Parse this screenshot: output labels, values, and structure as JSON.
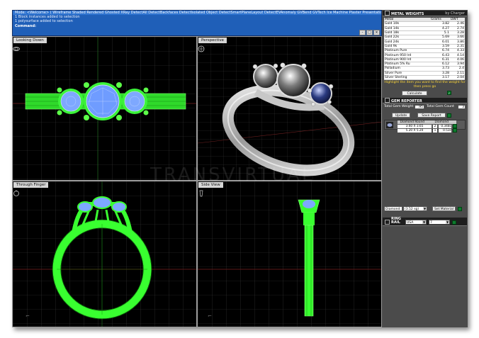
{
  "command_window": {
    "lines": [
      "Mode: <Welcome> ( Wireframe  Shaded  Rendered  Ghosted  XRay  DetectAll  DetectBackfaces  DetectIsolated  Object  DetectSmartPlaneLayout  DetectEVAnomaly  GVBend  GVTech  Ice  Machine  Plaster  Presentation",
      "1 Block instances added to selection",
      "1 polysurface added to selection",
      "Command:"
    ],
    "minimize": "-",
    "maximize": "□",
    "close": "×"
  },
  "viewports": {
    "top_left": "Looking Down",
    "top_right": "Perspective",
    "bottom_left": "Through Finger",
    "bottom_right": "Side View"
  },
  "metal_weights": {
    "title": "METAL WEIGHTS",
    "subtitle": "by Charger",
    "headers": [
      "Metal",
      "Grams",
      "DWT"
    ],
    "rows": [
      [
        "Gold 10k",
        "3.82",
        "2.46"
      ],
      [
        "Gold 14k",
        "4.27",
        "2.74"
      ],
      [
        "Gold 18k",
        "5.1",
        "3.28"
      ],
      [
        "Gold 22k",
        "5.69",
        "3.66"
      ],
      [
        "Gold 24k",
        "6.01",
        "3.86"
      ],
      [
        "Gold 9k",
        "3.59",
        "2.31"
      ],
      [
        "Platinum Pure",
        "6.74",
        "4.33"
      ],
      [
        "Platinum 950 Ird",
        "6.43",
        "4.14"
      ],
      [
        "Platinum 900 Ird",
        "6.31",
        "4.06"
      ],
      [
        "Platinum 5% Ru",
        "6.12",
        "3.94"
      ],
      [
        "Palladium",
        "3.73",
        "2.4"
      ],
      [
        "Silver Pure",
        "3.28",
        "2.11"
      ],
      [
        "Silver Sterling",
        "3.17",
        "2.04"
      ]
    ],
    "hint": "Highlight the item you want to find the weight for then press go",
    "calculate": "Calculate",
    "go": "✓"
  },
  "gem_reporter": {
    "title": "GEM REPORTER",
    "total_weight_label": "Total Gem Weight",
    "total_weight_value": ".95",
    "total_count_label": "Total Gem Count",
    "total_count_value": "3",
    "update": "Update",
    "save_report": "Save Report",
    "gem_headers": [
      "Diamond Round",
      "Diamond"
    ],
    "gem_rows": [
      {
        "size": "3.60 X 3.65",
        "count": "2",
        "weight": "0.348c"
      },
      {
        "size": "5.20 X 5.20",
        "count": "1",
        "weight": "0.53c"
      }
    ],
    "material_value": "Diamond",
    "material_sg": "(3.52 sg)",
    "set_material": "Set Material"
  },
  "ring_rail": {
    "label": "RING RAIL",
    "region": "USA",
    "size": "7"
  },
  "watermark": "TRANSVIRTUAL",
  "colors": {
    "command_bg": "#1f5fb8",
    "panel_bg": "#4b4b4b",
    "wire_green": "#39ff30",
    "gem_blue": "#7ea8ff",
    "hint_yellow": "#ffd83a"
  }
}
